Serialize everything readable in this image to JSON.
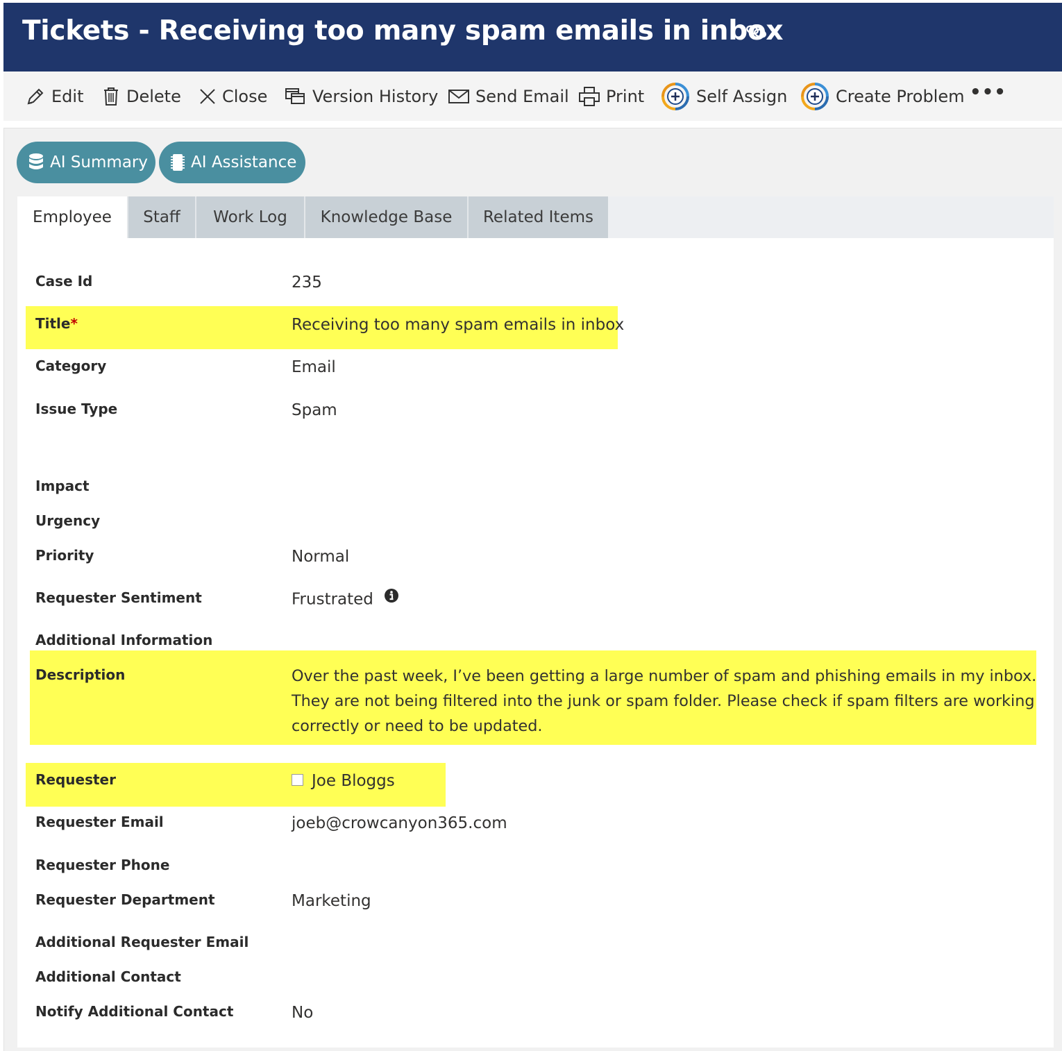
{
  "header": {
    "title": "Tickets - Receiving too many spam emails in inbox",
    "link_icon": "link-icon"
  },
  "toolbar": {
    "items": [
      {
        "label": "Edit",
        "icon": "pencil-icon"
      },
      {
        "label": "Delete",
        "icon": "trash-icon"
      },
      {
        "label": "Close",
        "icon": "close-icon"
      },
      {
        "label": "Version History",
        "icon": "version-history-icon"
      },
      {
        "label": "Send Email",
        "icon": "envelope-icon"
      },
      {
        "label": "Print",
        "icon": "printer-icon"
      },
      {
        "label": "Self Assign",
        "icon": "assign-plus-icon"
      },
      {
        "label": "Create Problem",
        "icon": "assign-plus-icon"
      }
    ],
    "more_label": "•••"
  },
  "ai_buttons": [
    {
      "label": "AI Summary",
      "icon": "database-icon"
    },
    {
      "label": "AI Assistance",
      "icon": "chip-icon"
    }
  ],
  "tabs": [
    {
      "label": "Employee",
      "active": true
    },
    {
      "label": "Staff",
      "active": false
    },
    {
      "label": "Work Log",
      "active": false
    },
    {
      "label": "Knowledge Base",
      "active": false
    },
    {
      "label": "Related Items",
      "active": false
    }
  ],
  "fields": {
    "case_id": {
      "label": "Case Id",
      "value": "235"
    },
    "title": {
      "label": "Title",
      "required_marker": "*",
      "value": "Receiving too many spam emails in inbox"
    },
    "category": {
      "label": "Category",
      "value": "Email"
    },
    "issue_type": {
      "label": "Issue Type",
      "value": "Spam"
    },
    "impact": {
      "label": "Impact",
      "value": ""
    },
    "urgency": {
      "label": "Urgency",
      "value": ""
    },
    "priority": {
      "label": "Priority",
      "value": "Normal"
    },
    "requester_sentiment": {
      "label": "Requester Sentiment",
      "value": "Frustrated",
      "icon": "info-icon"
    },
    "additional_information": {
      "label": "Additional Information",
      "value": ""
    },
    "description": {
      "label": "Description",
      "value": "Over the past week, I’ve been getting a large number of spam and phishing emails in my inbox. They are not being filtered into the junk or spam folder. Please check if spam filters are working correctly or need to be updated."
    },
    "requester": {
      "label": "Requester",
      "value": "Joe Bloggs"
    },
    "requester_email": {
      "label": "Requester Email",
      "value": "joeb@crowcanyon365.com"
    },
    "requester_phone": {
      "label": "Requester Phone",
      "value": ""
    },
    "requester_department": {
      "label": "Requester Department",
      "value": "Marketing"
    },
    "additional_requester_email": {
      "label": "Additional Requester Email",
      "value": ""
    },
    "additional_contact": {
      "label": "Additional Contact",
      "value": ""
    },
    "notify_additional_contact": {
      "label": "Notify Additional Contact",
      "value": "No"
    }
  },
  "colors": {
    "header_bg": "#1f366b",
    "ai_button": "#4a8fa0",
    "highlight": "#ffff55",
    "required": "#c00000"
  }
}
